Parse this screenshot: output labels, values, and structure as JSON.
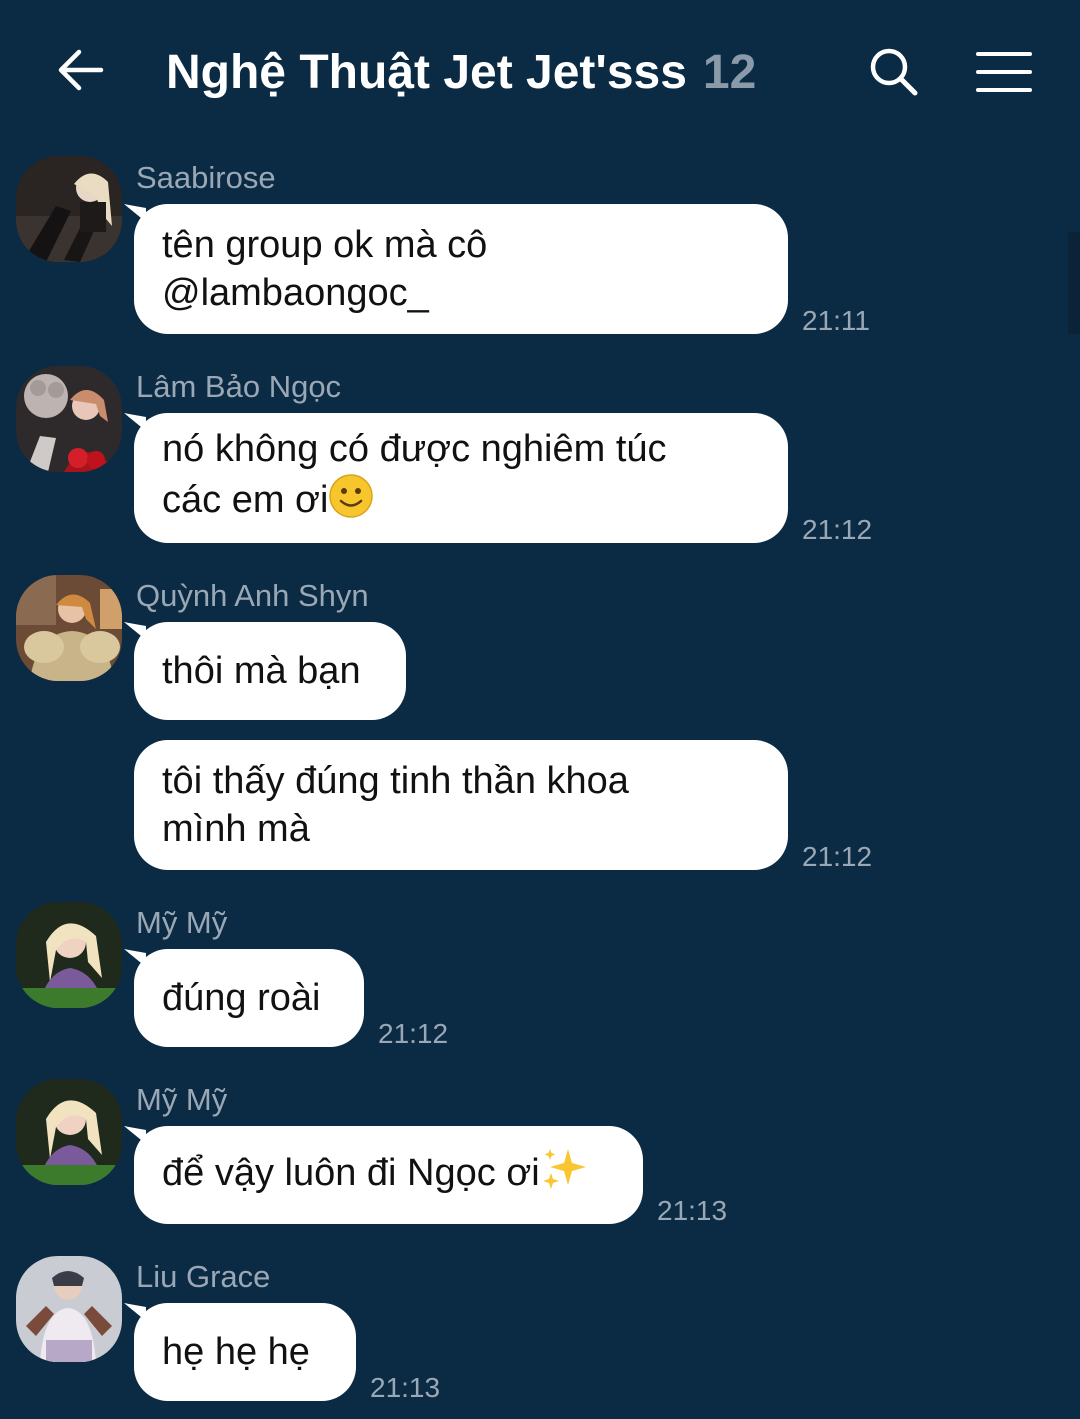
{
  "header": {
    "title": "Nghệ Thuật Jet Jet'sss",
    "member_count": "12",
    "back_icon": "arrow-left-icon",
    "search_icon": "search-icon",
    "menu_icon": "hamburger-menu-icon"
  },
  "messages": [
    {
      "sender": "Saabirose",
      "line1": "tên group ok mà cô",
      "line2": "@lambaongoc_",
      "time": "21:11"
    },
    {
      "sender": "Lâm Bảo Ngọc",
      "line1": "nó không có được nghiêm túc",
      "line2": "các em ơi",
      "emoji": "slightly-smiling-face-icon",
      "time": "21:12"
    },
    {
      "sender": "Quỳnh Anh Shyn",
      "line1": "thôi mà bạn"
    },
    {
      "line1": "tôi thấy đúng tinh thần khoa",
      "line2": "mình mà",
      "time": "21:12"
    },
    {
      "sender": "Mỹ Mỹ",
      "line1": "đúng roài",
      "time": "21:12"
    },
    {
      "sender": "Mỹ Mỹ",
      "line1": "để vậy luôn đi Ngọc ơi",
      "emoji": "sparkles-icon",
      "time": "21:13"
    },
    {
      "sender": "Liu Grace",
      "line1": "hẹ hẹ hẹ",
      "time": "21:13"
    }
  ],
  "colors": {
    "background": "#0b2a43",
    "bubble": "#ffffff",
    "meta_text": "#9aa8b6"
  }
}
